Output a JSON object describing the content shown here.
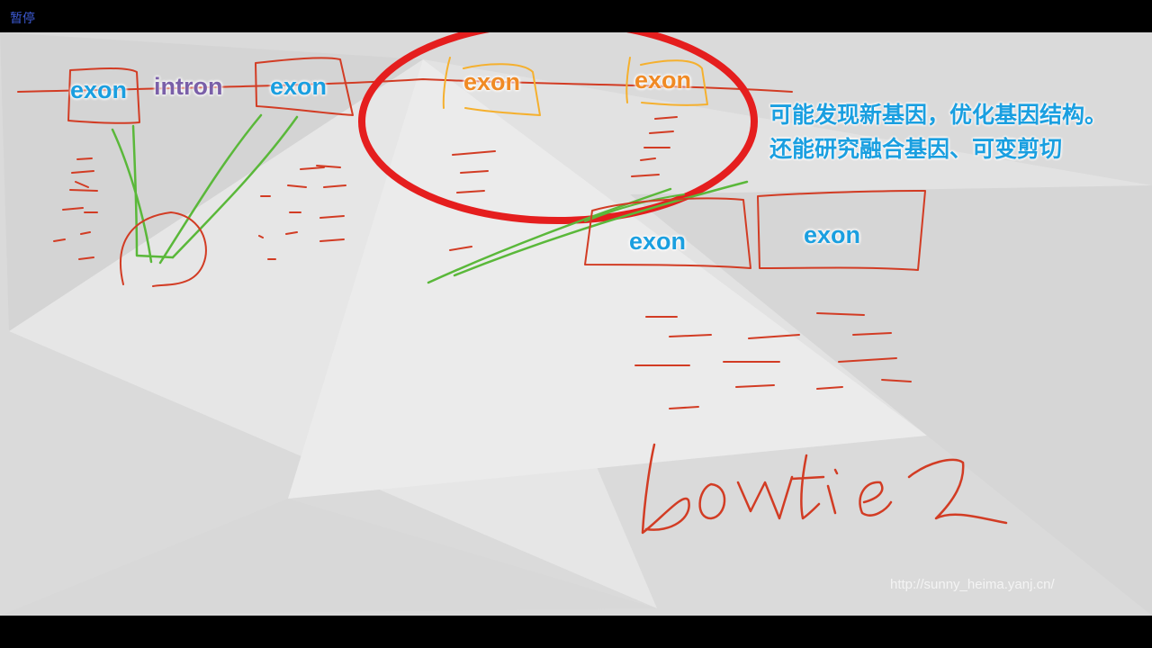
{
  "player": {
    "pause_label": "暂停"
  },
  "slide": {
    "labels": {
      "exon_1": "exon",
      "intron": "intron",
      "exon_2": "exon",
      "exon_3": "exon",
      "exon_4": "exon",
      "exon_5": "exon",
      "exon_6": "exon"
    },
    "note_line1": "可能发现新基因，优化基因结构。",
    "note_line2": "还能研究融合基因、可变剪切",
    "handwriting": "bowtie2",
    "watermark": "http://sunny_heima.yanj.cn/"
  },
  "colors": {
    "ink_red": "#d23c24",
    "ink_green": "#5ab83a",
    "ink_orange": "#f5b02e",
    "circle_red": "#e51e1e",
    "label_blue": "#1a9fe0",
    "label_orange": "#f08a24"
  }
}
